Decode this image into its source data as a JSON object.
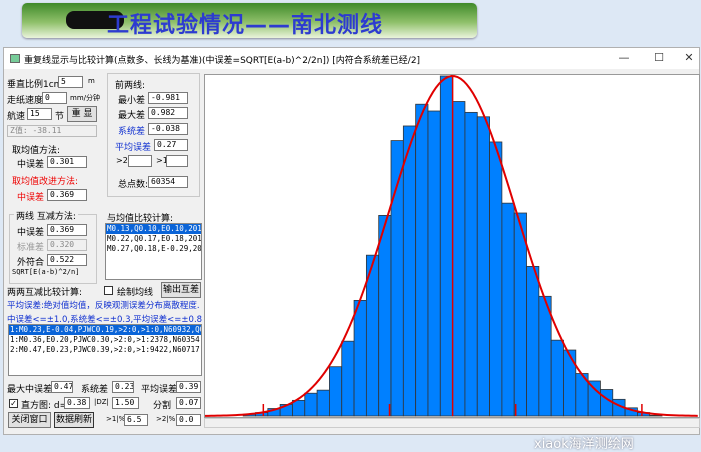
{
  "banner": {
    "title": "工程试验情况——南北测线"
  },
  "window": {
    "title": "重复线显示与比较计算(点数多、长线为基准)(中误差=SQRT[E(a-b)^2/2n]) [内符合系统差已经/2]",
    "min": "—",
    "max": "☐",
    "close": "✕"
  },
  "left": {
    "vscale_label": "垂直比例1cm=",
    "vscale_value": "5",
    "vscale_unit": "m",
    "paper_label": "走纸速度",
    "paper_value": "0",
    "paper_unit": "mm/分钟",
    "speed_label": "航速",
    "speed_value": "15",
    "speed_unit": "节",
    "redraw": "重 显",
    "z_value": "Z值: -38.11",
    "mean_method": "取均值方法:",
    "mean_err_label": "中误差",
    "mean_err": "0.301",
    "improved_method": "取均值改进方法:",
    "improved_err_label": "中误差",
    "improved_err": "0.369",
    "two_line_group": "两线 互减方法:",
    "tl_err_label": "中误差",
    "tl_err": "0.369",
    "tl_std_label": "标准差",
    "tl_std": "0.320",
    "tl_ext_label": "外符合",
    "tl_ext": "0.522",
    "formula": "SQRT[E(a-b)^2/n]"
  },
  "front": {
    "group": "前两线:",
    "min_label": "最小差",
    "min": "-0.981",
    "max_label": "最大差",
    "max": "0.982",
    "sys_label": "系统差",
    "sys": "-0.038",
    "avg_label": "平均误差",
    "avg": "0.27",
    "gt2": ">2",
    "gt2_value": "",
    "gt1": ">1",
    "gt1_value": "",
    "total_label": "总点数:",
    "total": "60354"
  },
  "mean_compare": {
    "label": "与均值比较计算:",
    "rows": [
      "M0.13,Q0.10,E0.10,20180",
      "M0.22,Q0.17,E0.18,20180",
      "M0.27,Q0.18,E-0.29,2018"
    ]
  },
  "pairwise": {
    "label": "两两互减比较计算:",
    "draw_mean": "绘制均线",
    "draw_mean_checked": false,
    "export": "输出互差",
    "note1": "平均误差:绝对值均值，反映观测误差分布离散程度.",
    "note2": "中误差<=±1.0,系统差<=±0.3,平均误差<=±0.8",
    "rows": [
      "1:M0.23,E-0.04,PJWC0.19,>2:0,>1:0,N60932,Q0.22,",
      "1:M0.36,E0.20,PJWC0.30,>2:0,>1:2378,N60354,Q0.2",
      "2:M0.47,E0.23,PJWC0.39,>2:0,>1:9422,N60717,Q0.3"
    ]
  },
  "bottom": {
    "max_err_label": "最大中误差",
    "max_err": "0.47",
    "sys_label": "系统差",
    "sys": "0.23",
    "avg_label": "平均误差",
    "avg": "0.39",
    "hist_checked": true,
    "hist_label": "直方图: d=",
    "d": "0.38",
    "dz_label": "|DZ|",
    "dz": "1.50",
    "split_label": "分割",
    "split": "0.07",
    "close": "关闭窗口",
    "refresh": "数据刷新",
    "gt1_label": ">1|%",
    "gt1": "6.5",
    "gt2_label": ">2|%",
    "gt2": "0.0"
  },
  "watermark": "xiaok海洋测绘网",
  "chart_data": {
    "type": "bar",
    "bin_width": 0.07,
    "bar_color": "#0080ff",
    "curve_color": "#e00000",
    "values": [
      0.5,
      1,
      2.2,
      3.4,
      4.6,
      6.7,
      7.6,
      14.5,
      22,
      34,
      47.3,
      59,
      81,
      85.3,
      91.7,
      89.7,
      100,
      92.5,
      89.3,
      88,
      80.6,
      62.6,
      59.7,
      44,
      35.2,
      22.3,
      19.4,
      12.5,
      10.3,
      7.8,
      4.9,
      2.4,
      1,
      0.2
    ],
    "xlim_bins": [
      -3.1,
      37
    ],
    "ylim": [
      0,
      100
    ],
    "mean_line_bin": 17,
    "fit": "normal"
  }
}
